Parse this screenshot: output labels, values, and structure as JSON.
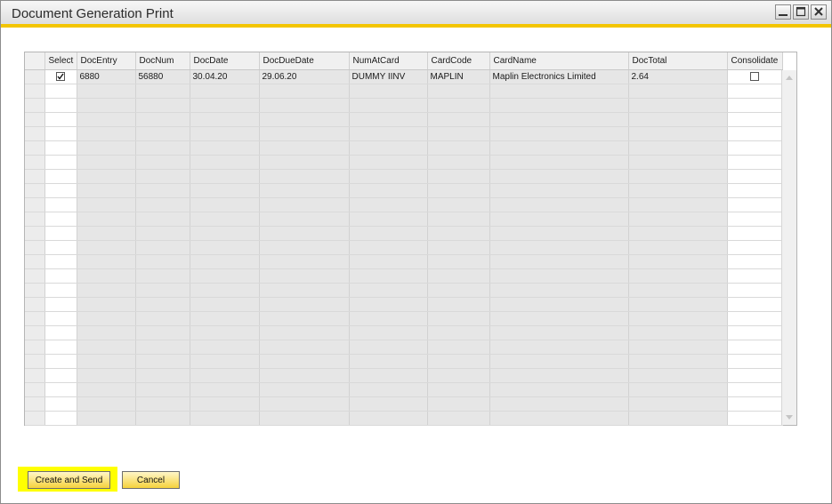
{
  "window": {
    "title": "Document Generation Print"
  },
  "grid": {
    "columns": [
      "Select",
      "DocEntry",
      "DocNum",
      "DocDate",
      "DocDueDate",
      "NumAtCard",
      "CardCode",
      "CardName",
      "DocTotal",
      "Consolidate"
    ],
    "rows": [
      {
        "select": true,
        "doc_entry": "6880",
        "doc_num": "56880",
        "doc_date": "30.04.20",
        "doc_due_date": "29.06.20",
        "num_at_card": "DUMMY IINV",
        "card_code": "MAPLIN",
        "card_name": "Maplin Electronics Limited",
        "doc_total": "2.64",
        "consolidate": false
      }
    ]
  },
  "buttons": {
    "create_and_send": "Create and Send",
    "cancel": "Cancel"
  },
  "colors": {
    "accent": "#f3c500",
    "button": "#f6d23c",
    "focus": "#ffff00"
  }
}
